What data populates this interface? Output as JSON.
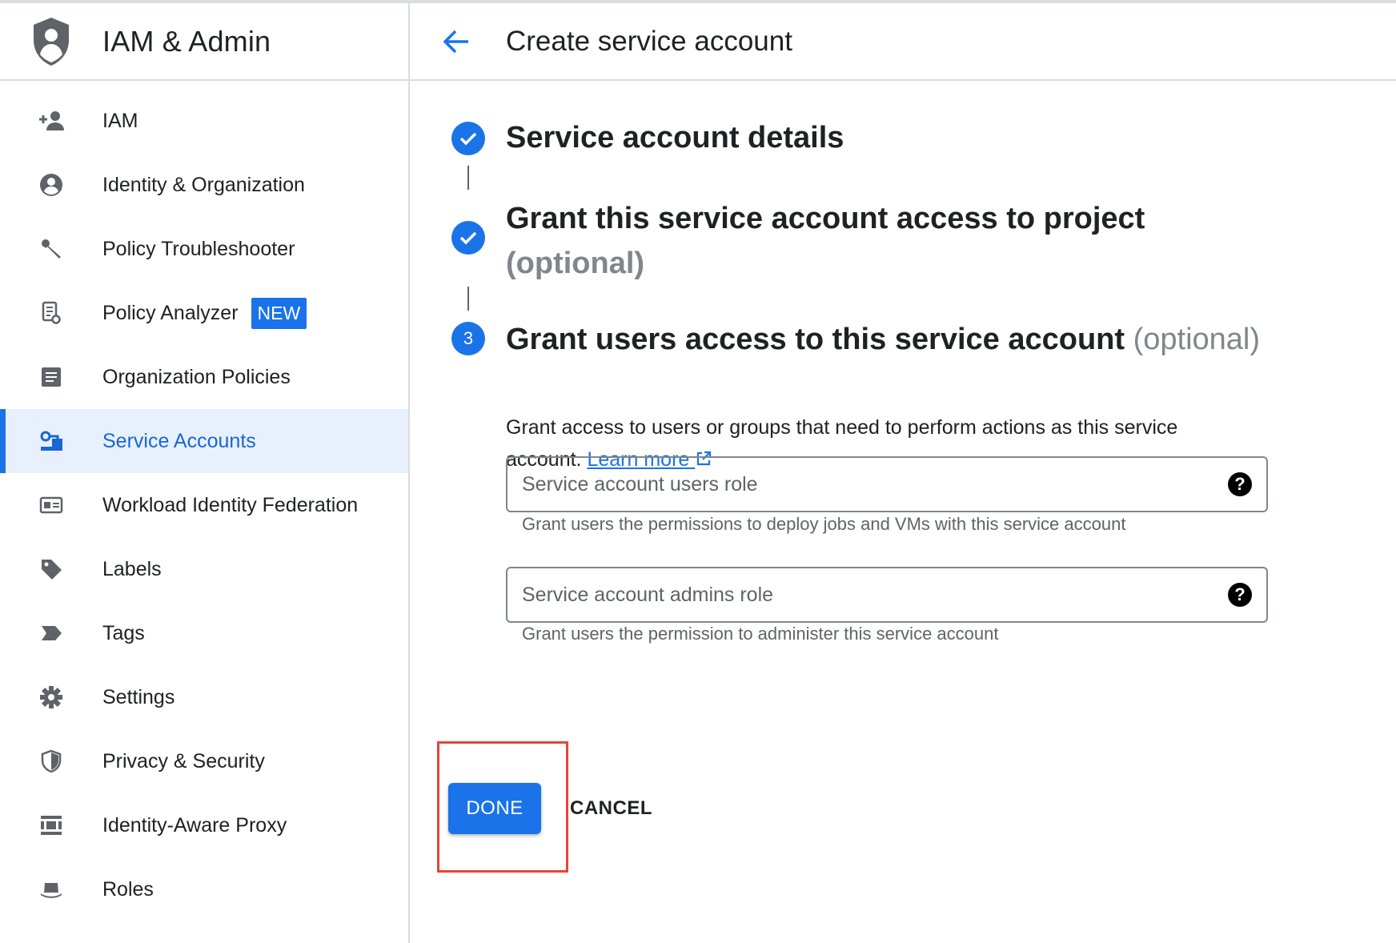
{
  "app": {
    "title": "IAM & Admin"
  },
  "sidebar": {
    "items": [
      {
        "label": "IAM",
        "icon": "person-add-icon"
      },
      {
        "label": "Identity & Organization",
        "icon": "account-circle-icon"
      },
      {
        "label": "Policy Troubleshooter",
        "icon": "wrench-icon"
      },
      {
        "label": "Policy Analyzer",
        "icon": "policy-analyzer-icon",
        "badge": "NEW"
      },
      {
        "label": "Organization Policies",
        "icon": "document-list-icon"
      },
      {
        "label": "Service Accounts",
        "icon": "service-account-icon",
        "active": true
      },
      {
        "label": "Workload Identity Federation",
        "icon": "id-card-icon"
      },
      {
        "label": "Labels",
        "icon": "label-tag-icon"
      },
      {
        "label": "Tags",
        "icon": "tag-arrow-icon"
      },
      {
        "label": "Settings",
        "icon": "gear-icon"
      },
      {
        "label": "Privacy & Security",
        "icon": "shield-icon"
      },
      {
        "label": "Identity-Aware Proxy",
        "icon": "proxy-icon"
      },
      {
        "label": "Roles",
        "icon": "hat-icon"
      }
    ]
  },
  "header": {
    "page_title": "Create service account"
  },
  "steps": [
    {
      "marker": "check",
      "title": "Service account details"
    },
    {
      "marker": "check",
      "title": "Grant this service account access to project",
      "optional": "(optional)"
    },
    {
      "marker": "3",
      "title": "Grant users access to this service account",
      "optional": "(optional)"
    }
  ],
  "step3": {
    "description": "Grant access to users or groups that need to perform actions as this service account.",
    "learn_more": "Learn more"
  },
  "fields": {
    "users_role": {
      "placeholder": "Service account users role",
      "value": "",
      "hint": "Grant users the permissions to deploy jobs and VMs with this service account"
    },
    "admins_role": {
      "placeholder": "Service account admins role",
      "value": "",
      "hint": "Grant users the permission to administer this service account"
    }
  },
  "actions": {
    "done_label": "DONE",
    "cancel_label": "CANCEL"
  },
  "colors": {
    "accent": "#1a73e8",
    "highlight": "#ea4335",
    "active_bg": "#e8f0fe"
  }
}
